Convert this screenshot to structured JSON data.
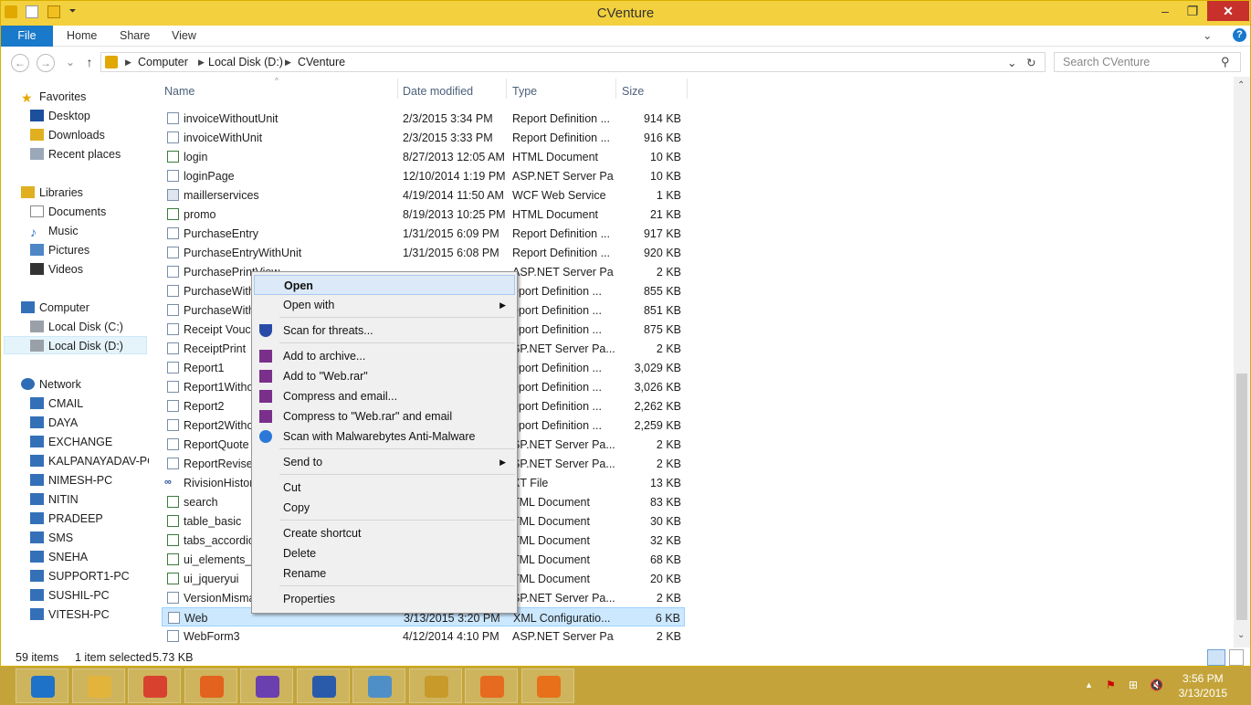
{
  "window": {
    "title": "CVenture",
    "minimize": "–",
    "restore": "❐",
    "close": "✕"
  },
  "ribbon": {
    "tabs": [
      "File",
      "Home",
      "Share",
      "View"
    ],
    "expand": "⌄",
    "help": "?"
  },
  "nav": {
    "back": "←",
    "forward": "→",
    "recent": "⌄",
    "up": "↑"
  },
  "address": {
    "segments": [
      "Computer",
      "Local Disk (D:)",
      "CVenture"
    ],
    "dropdown": "⌄",
    "refresh": "↻"
  },
  "search": {
    "placeholder": "Search CVenture",
    "icon": "⚲"
  },
  "sidebar": {
    "favorites": {
      "label": "Favorites",
      "items": [
        "Desktop",
        "Downloads",
        "Recent places"
      ]
    },
    "libraries": {
      "label": "Libraries",
      "items": [
        "Documents",
        "Music",
        "Pictures",
        "Videos"
      ]
    },
    "computer": {
      "label": "Computer",
      "items": [
        "Local Disk (C:)",
        "Local Disk (D:)"
      ]
    },
    "network": {
      "label": "Network",
      "items": [
        "CMAIL",
        "DAYA",
        "EXCHANGE",
        "KALPANAYADAV-PC",
        "NIMESH-PC",
        "NITIN",
        "PRADEEP",
        "SMS",
        "SNEHA",
        "SUPPORT1-PC",
        "SUSHIL-PC",
        "VITESH-PC"
      ]
    }
  },
  "columns": {
    "name": "Name",
    "date": "Date modified",
    "type": "Type",
    "size": "Size"
  },
  "files": [
    {
      "name": "invoiceWithoutUnit",
      "date": "2/3/2015 3:34 PM",
      "type": "Report Definition ...",
      "size": "914 KB",
      "icon": "report"
    },
    {
      "name": "invoiceWithUnit",
      "date": "2/3/2015 3:33 PM",
      "type": "Report Definition ...",
      "size": "916 KB",
      "icon": "report"
    },
    {
      "name": "login",
      "date": "8/27/2013 12:05 AM",
      "type": "HTML Document",
      "size": "10 KB",
      "icon": "html"
    },
    {
      "name": "loginPage",
      "date": "12/10/2014 1:19 PM",
      "type": "ASP.NET Server Pa...",
      "size": "10 KB",
      "icon": "aspx"
    },
    {
      "name": "maillerservices",
      "date": "4/19/2014 11:50 AM",
      "type": "WCF Web Service",
      "size": "1 KB",
      "icon": "svc"
    },
    {
      "name": "promo",
      "date": "8/19/2013 10:25 PM",
      "type": "HTML Document",
      "size": "21 KB",
      "icon": "html"
    },
    {
      "name": "PurchaseEntry",
      "date": "1/31/2015 6:09 PM",
      "type": "Report Definition ...",
      "size": "917 KB",
      "icon": "report"
    },
    {
      "name": "PurchaseEntryWithUnit",
      "date": "1/31/2015 6:08 PM",
      "type": "Report Definition ...",
      "size": "920 KB",
      "icon": "report"
    },
    {
      "name": "PurchasePrintView",
      "date": "",
      "type": "ASP.NET Server Pa...",
      "size": "2 KB",
      "icon": "aspx"
    },
    {
      "name": "PurchaseWith",
      "date": "",
      "type": "eport Definition ...",
      "size": "855 KB",
      "icon": "report"
    },
    {
      "name": "PurchaseWith",
      "date": "",
      "type": "eport Definition ...",
      "size": "851 KB",
      "icon": "report"
    },
    {
      "name": "Receipt Vouch",
      "date": "",
      "type": "eport Definition ...",
      "size": "875 KB",
      "icon": "report"
    },
    {
      "name": "ReceiptPrint",
      "date": "",
      "type": "SP.NET Server Pa...",
      "size": "2 KB",
      "icon": "aspx"
    },
    {
      "name": "Report1",
      "date": "",
      "type": "eport Definition ...",
      "size": "3,029 KB",
      "icon": "report"
    },
    {
      "name": "Report1Witho",
      "date": "",
      "type": "eport Definition ...",
      "size": "3,026 KB",
      "icon": "report"
    },
    {
      "name": "Report2",
      "date": "",
      "type": "eport Definition ...",
      "size": "2,262 KB",
      "icon": "report"
    },
    {
      "name": "Report2Witho",
      "date": "",
      "type": "eport Definition ...",
      "size": "2,259 KB",
      "icon": "report"
    },
    {
      "name": "ReportQuote",
      "date": "",
      "type": "SP.NET Server Pa...",
      "size": "2 KB",
      "icon": "aspx"
    },
    {
      "name": "ReportReviseC",
      "date": "",
      "type": "SP.NET Server Pa...",
      "size": "2 KB",
      "icon": "aspx"
    },
    {
      "name": "RivisionHistory",
      "date": "",
      "type": "XT File",
      "size": "13 KB",
      "icon": "txt"
    },
    {
      "name": "search",
      "date": "",
      "type": "TML Document",
      "size": "83 KB",
      "icon": "html"
    },
    {
      "name": "table_basic",
      "date": "",
      "type": "TML Document",
      "size": "30 KB",
      "icon": "html"
    },
    {
      "name": "tabs_accordion",
      "date": "",
      "type": "TML Document",
      "size": "32 KB",
      "icon": "html"
    },
    {
      "name": "ui_elements_b",
      "date": "",
      "type": "TML Document",
      "size": "68 KB",
      "icon": "html"
    },
    {
      "name": "ui_jqueryui",
      "date": "",
      "type": "TML Document",
      "size": "20 KB",
      "icon": "html"
    },
    {
      "name": "VersionMisma",
      "date": "",
      "type": "SP.NET Server Pa...",
      "size": "2 KB",
      "icon": "aspx"
    },
    {
      "name": "Web",
      "date": "3/13/2015 3:20 PM",
      "type": "XML Configuratio...",
      "size": "6 KB",
      "icon": "config",
      "selected": true
    },
    {
      "name": "WebForm3",
      "date": "4/12/2014 4:10 PM",
      "type": "ASP.NET Server Pa...",
      "size": "2 KB",
      "icon": "aspx"
    }
  ],
  "context_menu": {
    "items": [
      {
        "label": "Open",
        "highlight": true
      },
      {
        "label": "Open with",
        "submenu": true
      },
      {
        "sep": true
      },
      {
        "label": "Scan for threats...",
        "icon": "shield-icon"
      },
      {
        "sep": true
      },
      {
        "label": "Add to archive...",
        "icon": "winrar-icon"
      },
      {
        "label": "Add to \"Web.rar\"",
        "icon": "winrar-icon"
      },
      {
        "label": "Compress and email...",
        "icon": "winrar-icon"
      },
      {
        "label": "Compress to \"Web.rar\" and email",
        "icon": "winrar-icon"
      },
      {
        "label": "Scan with Malwarebytes Anti-Malware",
        "icon": "malwarebytes-icon"
      },
      {
        "sep": true
      },
      {
        "label": "Send to",
        "submenu": true
      },
      {
        "sep": true
      },
      {
        "label": "Cut"
      },
      {
        "label": "Copy"
      },
      {
        "sep": true
      },
      {
        "label": "Create shortcut"
      },
      {
        "label": "Delete"
      },
      {
        "label": "Rename"
      },
      {
        "sep": true
      },
      {
        "label": "Properties"
      }
    ],
    "submenu_arrow": "▶"
  },
  "status": {
    "items": "59 items",
    "selected": "1 item selected",
    "size": "5.73 KB"
  },
  "taskbar": {
    "apps": [
      "ie-icon",
      "file-explorer-icon",
      "chrome-icon",
      "firefox-icon",
      "visual-studio-icon",
      "word-icon",
      "network-tool-icon",
      "snipping-tool-icon",
      "fire-app-icon",
      "outlook-icon"
    ],
    "tray": {
      "chevron": "▲",
      "flag": "⚑",
      "network": "⊞",
      "volume": "🔇"
    },
    "time": "3:56 PM",
    "date": "3/13/2015"
  },
  "colors": {
    "titlebar": "#f3d03e",
    "taskbar": "#c4a43a",
    "accent": "#1979ca",
    "close": "#c7302b",
    "selection": "#cce8ff"
  }
}
